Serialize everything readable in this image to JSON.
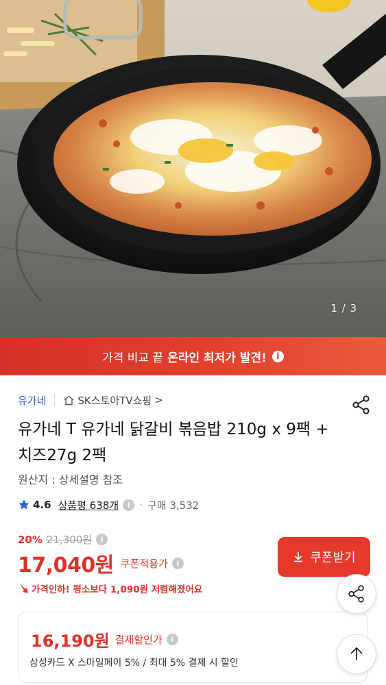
{
  "image": {
    "counter": "1 / 3"
  },
  "banner": {
    "prefix": "가격 비교 끝",
    "highlight": "온라인 최저가 발견!",
    "info_glyph": "i"
  },
  "seller": {
    "brand": "유가네",
    "store": "SK스토아TV쇼핑",
    "chevron": ">"
  },
  "product": {
    "title": "유가네 T 유가네 닭갈비 볶음밥 210g x 9팩 + 치즈27g 2팩",
    "origin": "원산지 : 상세설명 참조"
  },
  "rating": {
    "score": "4.6",
    "reviews": "상품평 638개",
    "dot": "·",
    "purchase": "구매 3,532"
  },
  "pricing": {
    "discount_rate": "20%",
    "original_price": "21,300원",
    "price": "17,040원",
    "price_label": "쿠폰적용가",
    "coupon_button": "쿠폰받기",
    "price_drop_note": "가격인하! 평소보다 1,090원 저렴해졌어요"
  },
  "payment": {
    "price": "16,190원",
    "label": "결제할인가",
    "desc": "삼성카드 X 스마일페이 5%  / 최대 5% 결제 시 할인"
  },
  "colors": {
    "accent": "#e0302a",
    "link": "#2c59c8",
    "star": "#2f63d6"
  },
  "icons": [
    "share-icon",
    "home-icon",
    "star-icon",
    "info-icon",
    "download-icon",
    "arrow-up-icon",
    "price-down-icon"
  ]
}
